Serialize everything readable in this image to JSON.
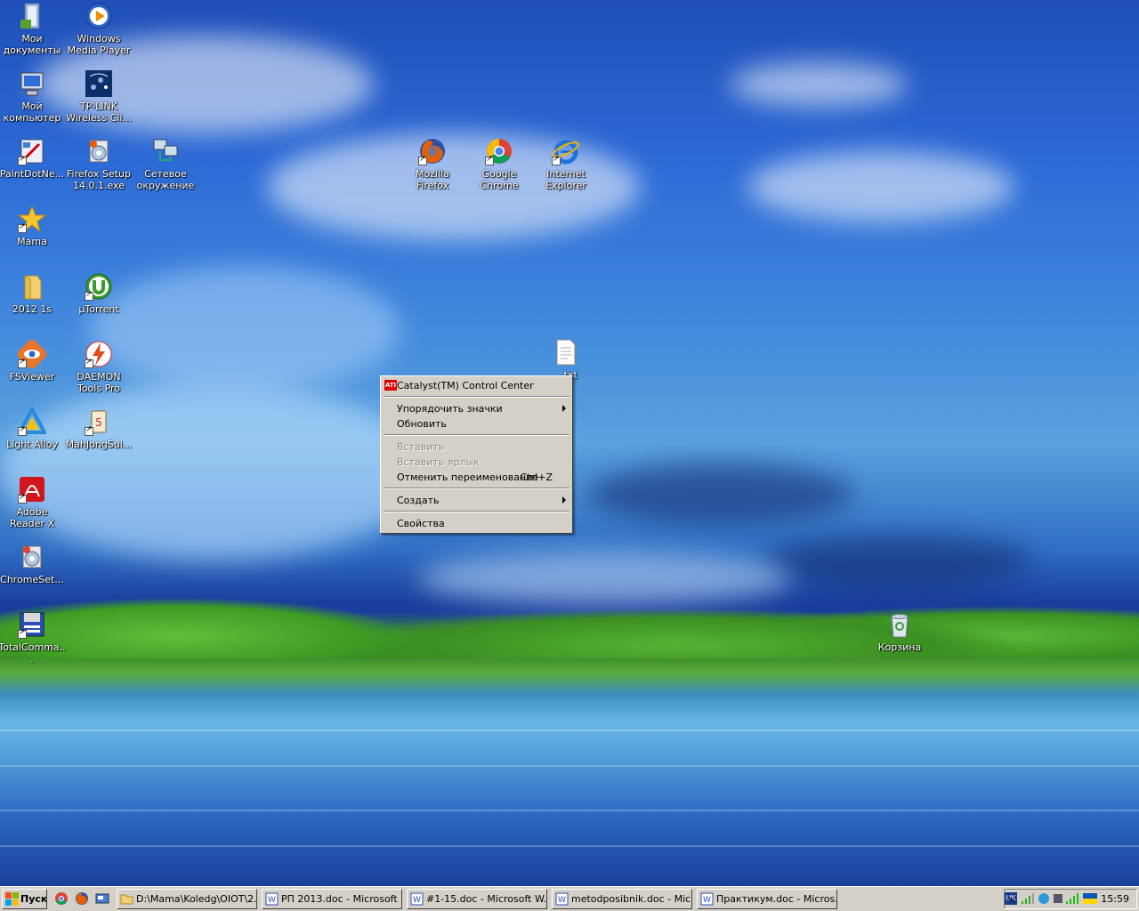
{
  "desktop": {
    "icons": [
      {
        "label": "Мои документы",
        "icon": "my-documents-icon"
      },
      {
        "label": "Windows Media Player",
        "icon": "media-player-icon"
      },
      {
        "label": "Мой компьютер",
        "icon": "my-computer-icon"
      },
      {
        "label": "TP-LINK Wireless Cli...",
        "icon": "tplink-icon"
      },
      {
        "label": "PaintDotNe...",
        "icon": "paintdotnet-icon"
      },
      {
        "label": "Firefox Setup 14.0.1.exe",
        "icon": "firefox-setup-icon"
      },
      {
        "label": "Сетевое окружение",
        "icon": "network-icon"
      },
      {
        "label": "Mozilla Firefox",
        "icon": "firefox-icon"
      },
      {
        "label": "Google Chrome",
        "icon": "chrome-icon"
      },
      {
        "label": "Internet Explorer",
        "icon": "ie-icon"
      },
      {
        "label": "Mama",
        "icon": "star-icon"
      },
      {
        "label": "2012 1s",
        "icon": "folder-icon"
      },
      {
        "label": "µTorrent",
        "icon": "utorrent-icon"
      },
      {
        "label": "FSViewer",
        "icon": "fsviewer-icon"
      },
      {
        "label": "DAEMON Tools Pro",
        "icon": "daemon-tools-icon"
      },
      {
        "label": "Light Alloy",
        "icon": "light-alloy-icon"
      },
      {
        "label": "MahJongSui...",
        "icon": "mahjong-icon"
      },
      {
        "label": "Adobe Reader X",
        "icon": "adobe-reader-icon"
      },
      {
        "label": "ChromeSet...",
        "icon": "chrome-setup-icon"
      },
      {
        "label": "TotalComma...",
        "icon": "total-commander-icon"
      },
      {
        "label": "Корзина",
        "icon": "recycle-bin-icon"
      },
      {
        "label": "...txt",
        "icon": "text-file-icon"
      }
    ]
  },
  "context_menu": {
    "items": {
      "catalyst": "Catalyst(TM) Control Center",
      "arrange": "Упорядочить значки",
      "refresh": "Обновить",
      "paste": "Вставить",
      "paste_shortcut": "Вставить ярлык",
      "undo_rename": "Отменить переименование",
      "undo_shortcut": "Ctrl+Z",
      "new": "Создать",
      "properties": "Свойства"
    },
    "ati_logo": "ATI"
  },
  "taskbar": {
    "start_label": "Пуск",
    "windows": [
      "D:\\Mama\\Koledg\\OIOT\\2...",
      "РП 2013.doc - Microsoft ...",
      "#1-15.doc - Microsoft W...",
      "metodposibnik.doc - Micr...",
      "Практикум.doc - Micros..."
    ],
    "tray": {
      "language": "UK",
      "chevron": "«",
      "clock": "15:59"
    }
  }
}
